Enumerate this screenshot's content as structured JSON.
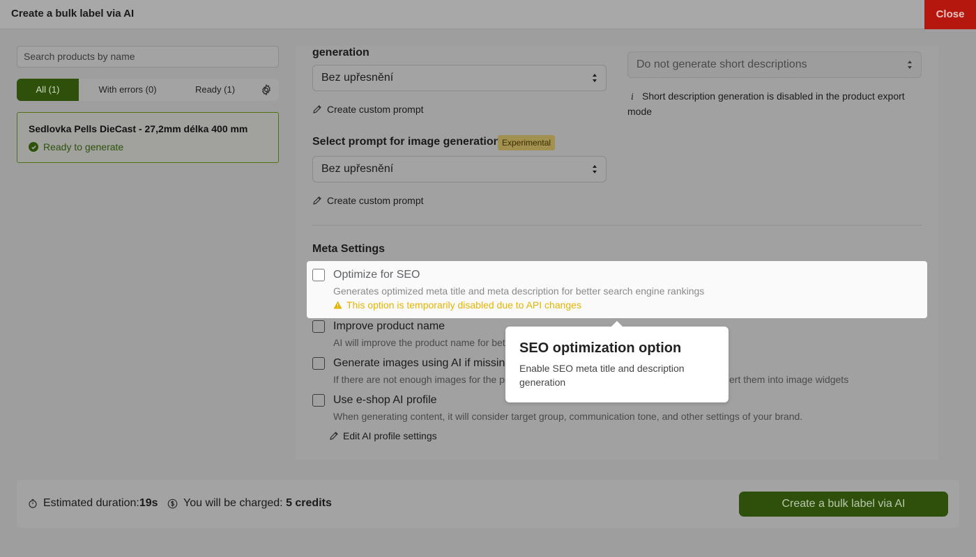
{
  "header": {
    "title": "Create a bulk label via AI",
    "close_label": "Close"
  },
  "sidebar": {
    "search_placeholder": "Search products by name",
    "tabs": [
      {
        "label": "All (1)",
        "active": true
      },
      {
        "label": "With errors (0)"
      },
      {
        "label": "Ready (1)"
      }
    ],
    "product": {
      "name": "Sedlovka Pells DieCast - 27,2mm délka 400 mm",
      "status": "Ready to generate"
    }
  },
  "main": {
    "description_prompt": {
      "label": "generation",
      "selected": "Bez upřesnění",
      "custom_prompt": "Create custom prompt"
    },
    "image_prompt": {
      "label": "Select prompt for image generation",
      "badge": "Experimental",
      "selected": "Bez upřesnění",
      "custom_prompt": "Create custom prompt"
    },
    "short_description": {
      "selected": "Do not generate short descriptions",
      "info": "Short description generation is disabled in the product export mode",
      "info_icon": "i"
    },
    "meta_settings": {
      "title": "Meta Settings",
      "options": [
        {
          "title": "Optimize for SEO",
          "desc": "Generates optimized meta title and meta description for better search engine rankings",
          "warning": "This option is temporarily disabled due to API changes",
          "checked": false
        },
        {
          "title": "Improve product name",
          "desc": "AI will improve the product name for bet",
          "checked": false
        },
        {
          "title": "Generate images using AI if missing",
          "desc": "If there are not enough images for the pr",
          "desc_tail": "ert them into image widgets",
          "checked": false
        },
        {
          "title": "Use e-shop AI profile",
          "desc": "When generating content, it will consider target group, communication tone, and other settings of your brand.",
          "checked": false
        }
      ],
      "edit_profile": "Edit AI profile settings"
    }
  },
  "tooltip": {
    "title": "SEO optimization option",
    "body": "Enable SEO meta title and description generation"
  },
  "footer": {
    "duration_label": "Estimated duration:",
    "duration_value": "19s",
    "charge_label": "You will be charged: ",
    "charge_value": "5 credits",
    "create_label": "Create a bulk label via AI"
  },
  "colors": {
    "brand": "#2e500b",
    "close": "#b5170f",
    "warning": "#e3b400",
    "badge": "#a1904f"
  },
  "icons": [
    "gear-icon",
    "check-circle-icon",
    "pencil-icon",
    "info-icon",
    "warning-icon",
    "timer-icon",
    "coin-icon",
    "select-arrows-icon"
  ]
}
